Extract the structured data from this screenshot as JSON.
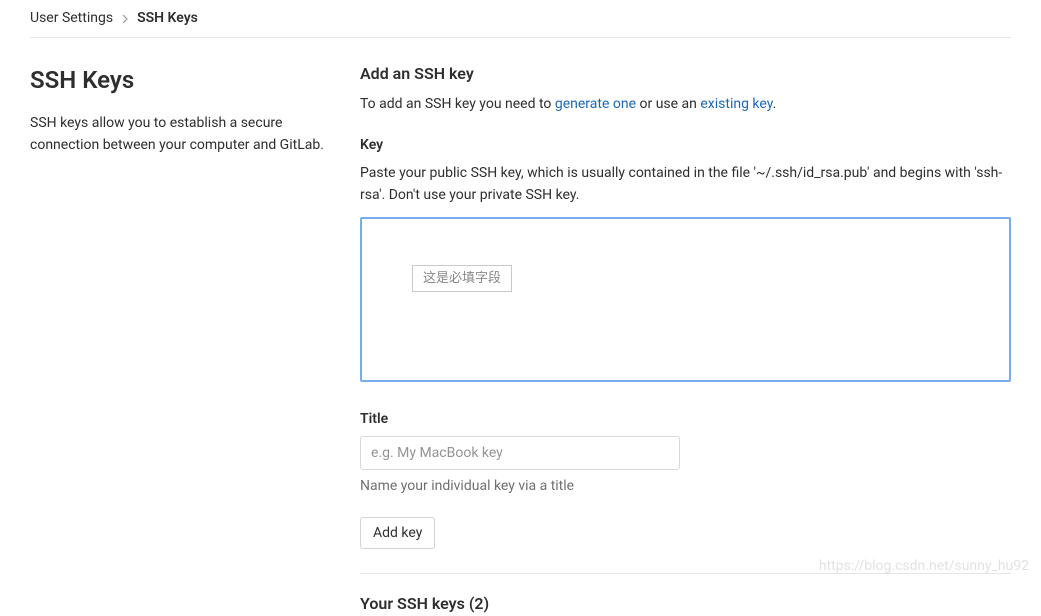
{
  "breadcrumb": {
    "parent": "User Settings",
    "current": "SSH Keys"
  },
  "left": {
    "title": "SSH Keys",
    "description": "SSH keys allow you to establish a secure connection between your computer and GitLab."
  },
  "main": {
    "heading": "Add an SSH key",
    "intro_prefix": "To add an SSH key you need to ",
    "link_generate": "generate one",
    "intro_mid": " or use an ",
    "link_existing": "existing key",
    "intro_suffix": ".",
    "key_label": "Key",
    "key_desc": "Paste your public SSH key, which is usually contained in the file '~/.ssh/id_rsa.pub' and begins with 'ssh-rsa'. Don't use your private SSH key.",
    "key_value": "",
    "tooltip": "这是必填字段",
    "title_label": "Title",
    "title_placeholder": "e.g. My MacBook key",
    "title_help": "Name your individual key via a title",
    "add_button": "Add key",
    "your_keys_heading": "Your SSH keys (2)"
  },
  "watermark": "https://blog.csdn.net/sunny_hu92"
}
